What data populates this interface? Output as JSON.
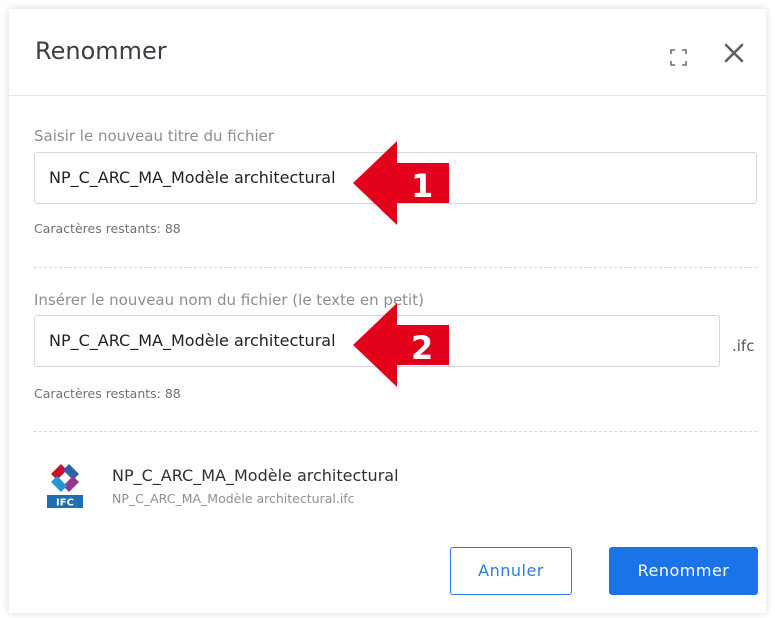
{
  "dialog": {
    "title": "Renommer"
  },
  "title_field": {
    "label": "Saisir le nouveau titre du fichier",
    "value": "NP_C_ARC_MA_Modèle architectural",
    "hint": "Caractères restants: 88"
  },
  "name_field": {
    "label": "Insérer le nouveau nom du fichier (le texte en petit)",
    "value": "NP_C_ARC_MA_Modèle architectural",
    "extension": ".ifc",
    "hint": "Caractères restants: 88"
  },
  "file_preview": {
    "icon": "ifc-file-icon",
    "icon_label": "IFC",
    "name": "NP_C_ARC_MA_Modèle architectural",
    "filename": "NP_C_ARC_MA_Modèle architectural.ifc"
  },
  "buttons": {
    "cancel": "Annuler",
    "rename": "Renommer"
  },
  "annotations": {
    "arrow1": "1",
    "arrow2": "2",
    "color": "#e3001b"
  },
  "colors": {
    "primary": "#1a73e8",
    "border": "#d4d7dc"
  }
}
